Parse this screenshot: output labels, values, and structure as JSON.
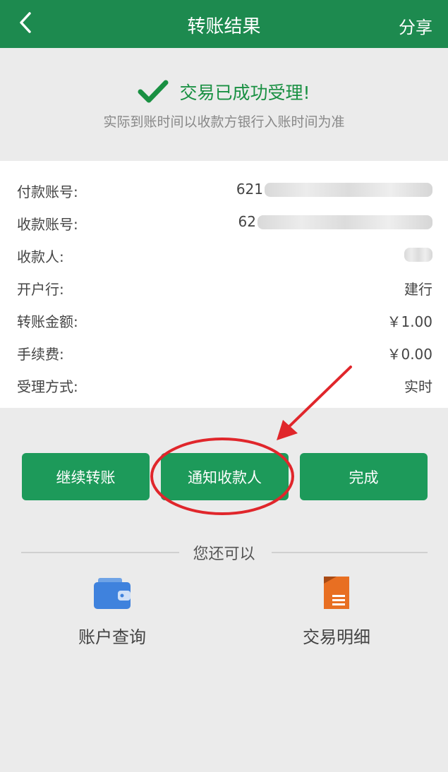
{
  "header": {
    "title": "转账结果",
    "share_label": "分享"
  },
  "result": {
    "title": "交易已成功受理!",
    "subtitle": "实际到账时间以收款方银行入账时间为准"
  },
  "details": [
    {
      "label": "付款账号:",
      "value": "621"
    },
    {
      "label": "收款账号:",
      "value": "62"
    },
    {
      "label": "收款人:",
      "value": ""
    },
    {
      "label": "开户行:",
      "value": "建行"
    },
    {
      "label": "转账金额:",
      "value": "￥1.00"
    },
    {
      "label": "手续费:",
      "value": "￥0.00"
    },
    {
      "label": "受理方式:",
      "value": "实时"
    }
  ],
  "actions": {
    "continue_label": "继续转账",
    "notify_label": "通知收款人",
    "done_label": "完成"
  },
  "also": {
    "title": "您还可以",
    "items": [
      {
        "label": "账户查询",
        "icon": "wallet-icon"
      },
      {
        "label": "交易明细",
        "icon": "document-icon"
      }
    ]
  },
  "colors": {
    "brand_green": "#1d8a4f",
    "button_green": "#1d9a5a",
    "success_green": "#199042",
    "annotation_red": "#e0262b"
  }
}
